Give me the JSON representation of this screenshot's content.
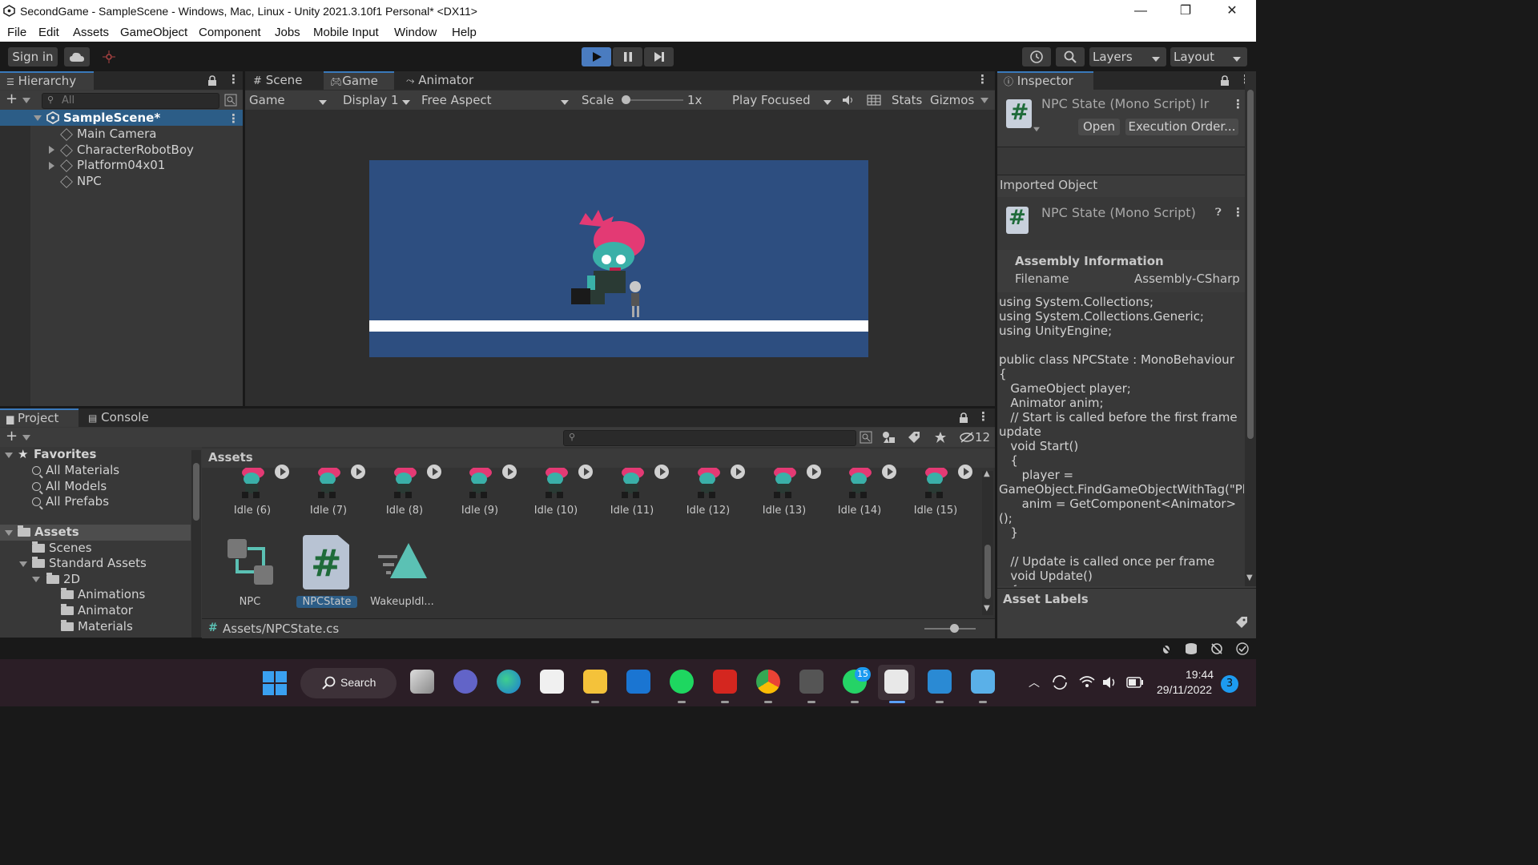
{
  "window": {
    "title": "SecondGame - SampleScene - Windows, Mac, Linux - Unity 2021.3.10f1 Personal* <DX11>",
    "minimize": "—",
    "maximize": "❐",
    "close": "✕"
  },
  "menu": [
    "File",
    "Edit",
    "Assets",
    "GameObject",
    "Component",
    "Jobs",
    "Mobile Input",
    "Window",
    "Help"
  ],
  "toolbar": {
    "sign_in": "Sign in",
    "layers": "Layers",
    "layout": "Layout"
  },
  "hierarchy": {
    "tab": "Hierarchy",
    "search_placeholder": "All",
    "scene": "SampleScene*",
    "items": [
      "Main Camera",
      "CharacterRobotBoy",
      "Platform04x01",
      "NPC"
    ]
  },
  "scene_tabs": {
    "scene": "Scene",
    "game": "Game",
    "animator": "Animator"
  },
  "game_bar": {
    "view": "Game",
    "display": "Display 1",
    "aspect": "Free Aspect",
    "scale_label": "Scale",
    "scale_value": "1x",
    "play_mode": "Play Focused",
    "stats": "Stats",
    "gizmos": "Gizmos"
  },
  "game_view": {
    "background": "#2d4e80",
    "platform": "#ffffff"
  },
  "project": {
    "tab_project": "Project",
    "tab_console": "Console",
    "hidden_count": "12",
    "favorites_title": "Favorites",
    "favorites": [
      "All Materials",
      "All Models",
      "All Prefabs"
    ],
    "assets_title": "Assets",
    "tree": {
      "scenes": "Scenes",
      "standard_assets": "Standard Assets",
      "twod": "2D",
      "animations": "Animations",
      "animator": "Animator",
      "materials": "Materials"
    },
    "breadcrumb": "Assets",
    "idle_items": [
      "Idle (6)",
      "Idle (7)",
      "Idle (8)",
      "Idle (9)",
      "Idle (10)",
      "Idle (11)",
      "Idle (12)",
      "Idle (13)",
      "Idle (14)",
      "Idle (15)"
    ],
    "other_items": [
      "NPC",
      "NPCState",
      "WakeupIdl..."
    ],
    "status_path": "Assets/NPCState.cs"
  },
  "inspector": {
    "tab": "Inspector",
    "header_title": "NPC State (Mono Script) Ir",
    "open": "Open",
    "execution_order": "Execution Order...",
    "imported_object": "Imported Object",
    "script_title": "NPC State (Mono Script)",
    "assembly_info": "Assembly Information",
    "filename_label": "Filename",
    "filename_value": "Assembly-CSharp",
    "code": "using System.Collections;\nusing System.Collections.Generic;\nusing UnityEngine;\n\npublic class NPCState : MonoBehaviour\n{\n   GameObject player;\n   Animator anim;\n   // Start is called before the first frame update\n   void Start()\n   {\n      player = GameObject.FindGameObjectWithTag(\"Player\");\n      anim = GetComponent<Animator> ();\n   }\n\n   // Update is called once per frame\n   void Update()\n   {",
    "asset_labels": "Asset Labels"
  },
  "taskbar": {
    "search": "Search",
    "whatsapp_badge": "15",
    "time": "19:44",
    "date": "29/11/2022",
    "notifications": "3"
  }
}
